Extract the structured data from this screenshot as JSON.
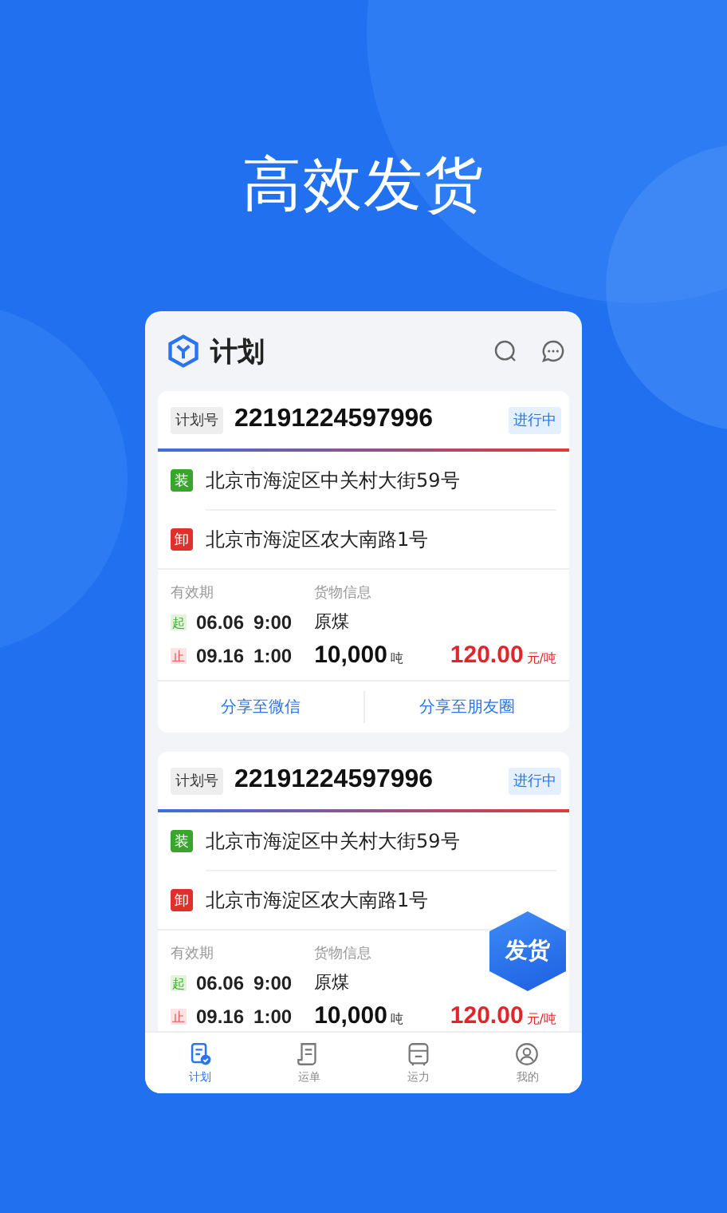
{
  "headline": "高效发货",
  "app": {
    "title": "计划"
  },
  "plans": [
    {
      "label": "计划号",
      "number": "22191224597996",
      "status": "进行中",
      "stops": [
        {
          "kind": "load",
          "tag": "装",
          "address": "北京市海淀区中关村大街59号"
        },
        {
          "kind": "unload",
          "tag": "卸",
          "address": "北京市海淀区农大南路1号"
        }
      ],
      "validity_label": "有效期",
      "start_tag": "起",
      "start_date": "06.06",
      "start_time": "9:00",
      "end_tag": "止",
      "end_date": "09.16",
      "end_time": "1:00",
      "cargo_label": "货物信息",
      "cargo": "原煤",
      "quantity": "10,000",
      "quantity_unit": "吨",
      "price": "120.00",
      "price_unit": "元/吨",
      "share_buttons": [
        "分享至微信",
        "分享至朋友圈"
      ]
    },
    {
      "label": "计划号",
      "number": "22191224597996",
      "status": "进行中",
      "stops": [
        {
          "kind": "load",
          "tag": "装",
          "address": "北京市海淀区中关村大街59号"
        },
        {
          "kind": "unload",
          "tag": "卸",
          "address": "北京市海淀区农大南路1号"
        }
      ],
      "validity_label": "有效期",
      "start_tag": "起",
      "start_date": "06.06",
      "start_time": "9:00",
      "end_tag": "止",
      "end_date": "09.16",
      "end_time": "1:00",
      "cargo_label": "货物信息",
      "cargo": "原煤",
      "quantity": "10,000",
      "quantity_unit": "吨",
      "price": "120.00",
      "price_unit": "元/吨"
    }
  ],
  "fab": "发货",
  "tabs": [
    {
      "kind": "plan",
      "label": "计划",
      "selected": true
    },
    {
      "kind": "waybill",
      "label": "运单",
      "selected": false
    },
    {
      "kind": "capacity",
      "label": "运力",
      "selected": false
    },
    {
      "kind": "me",
      "label": "我的",
      "selected": false
    }
  ]
}
